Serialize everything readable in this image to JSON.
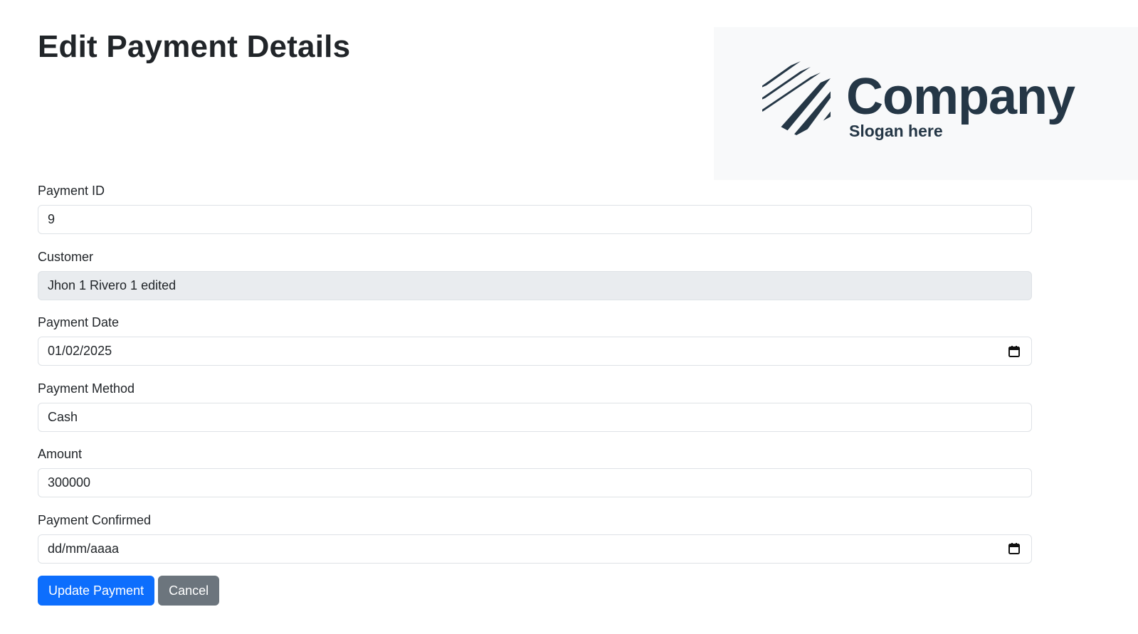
{
  "page": {
    "title": "Edit Payment Details"
  },
  "logo": {
    "name": "Company",
    "slogan": "Slogan here",
    "color": "#253746"
  },
  "form": {
    "fields": [
      {
        "label": "Payment ID",
        "value": "9",
        "type": "text",
        "readonly": false
      },
      {
        "label": "Customer",
        "value": "Jhon 1 Rivero 1 edited",
        "type": "text",
        "readonly": true
      },
      {
        "label": "Payment Date",
        "value": "01/02/2025",
        "type": "date",
        "icon": "calendar-icon"
      },
      {
        "label": "Payment Method",
        "value": "Cash",
        "type": "text",
        "readonly": false
      },
      {
        "label": "Amount",
        "value": "300000",
        "type": "text",
        "readonly": false
      },
      {
        "label": "Payment Confirmed",
        "value": "dd/mm/aaaa",
        "type": "date",
        "icon": "calendar-icon"
      }
    ]
  },
  "buttons": {
    "update_label": "Update Payment",
    "cancel_label": "Cancel"
  },
  "colors": {
    "primary": "#0d6efd",
    "secondary": "#6c757d",
    "readonly_bg": "#e9ecef",
    "border": "#dee2e6"
  }
}
